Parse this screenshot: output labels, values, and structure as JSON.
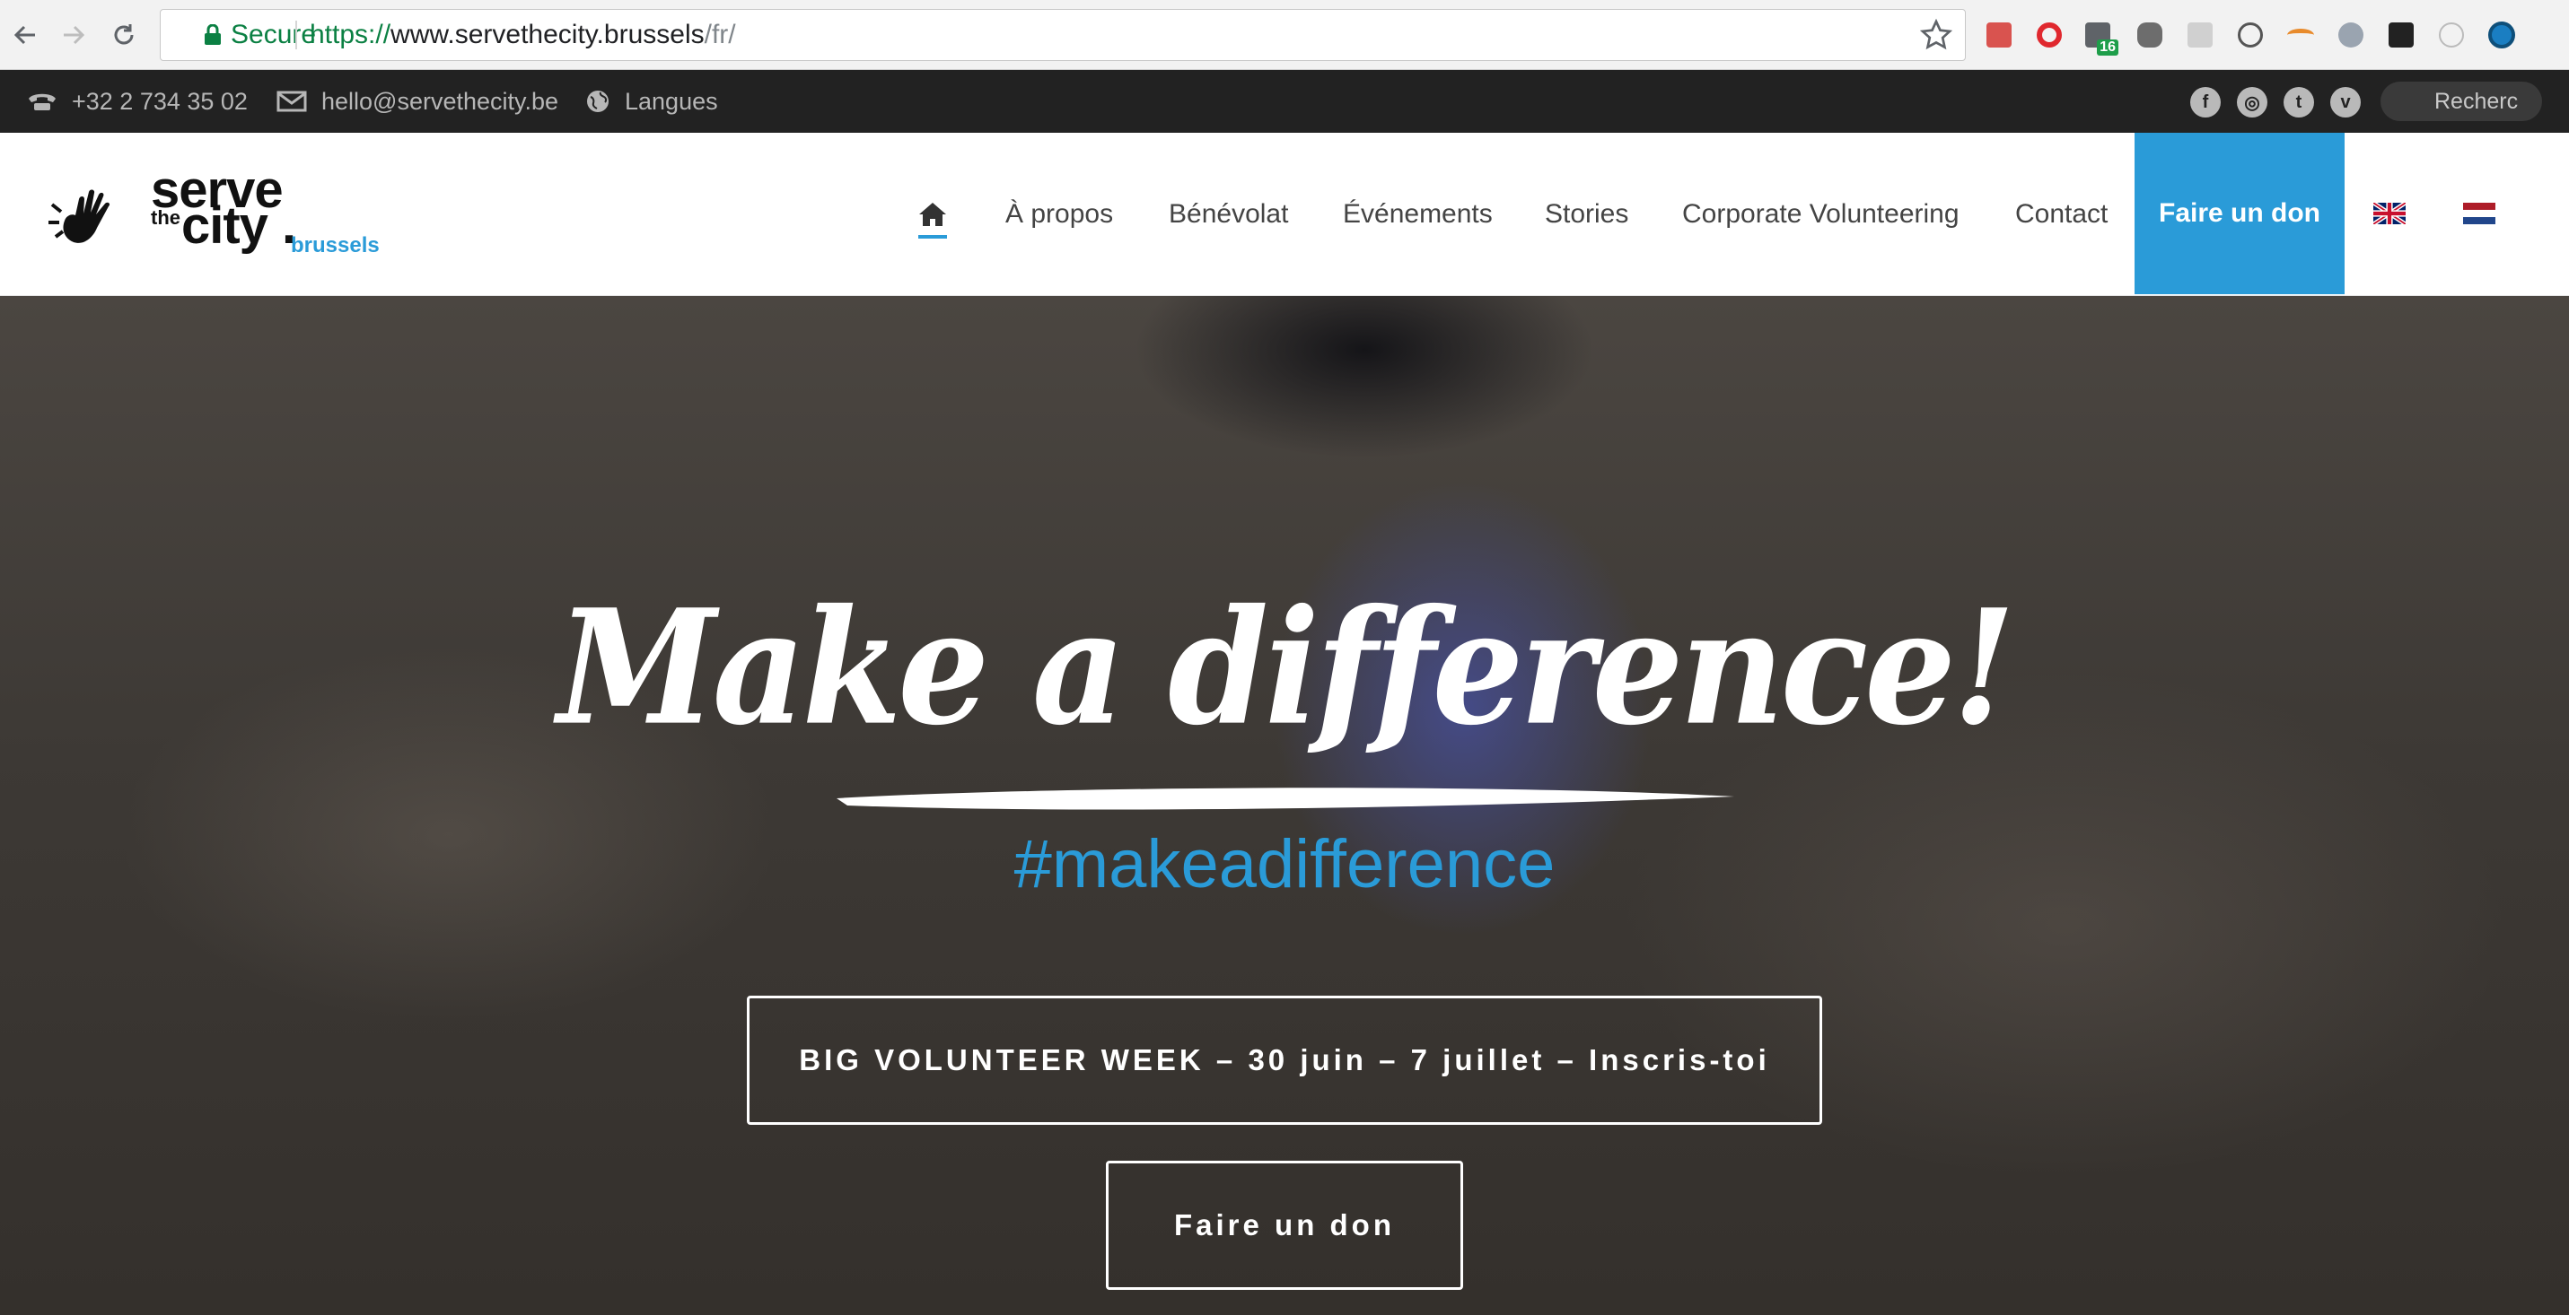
{
  "browser": {
    "secure_label": "Secure",
    "url_scheme": "https://",
    "url_host": "www.servethecity.brussels",
    "url_path": "/fr/",
    "extension_badge": "16"
  },
  "topbar": {
    "phone": "+32 2 734 35 02",
    "email": "hello@servethecity.be",
    "languages": "Langues",
    "social": [
      "f",
      "◎",
      "t",
      "v"
    ],
    "search_placeholder": "Recherc"
  },
  "logo": {
    "serve": "serve",
    "the": "the",
    "city": "city",
    "dot": ".",
    "brussels": "brussels"
  },
  "nav": {
    "items": [
      "À propos",
      "Bénévolat",
      "Événements",
      "Stories",
      "Corporate Volunteering",
      "Contact"
    ],
    "donate": "Faire un don"
  },
  "hero": {
    "title": "Make a difference!",
    "hashtag": "#makeadifference",
    "cta_primary": "BIG VOLUNTEER WEEK – 30 juin – 7 juillet – Inscris-toi",
    "cta_secondary": "Faire un don"
  },
  "colors": {
    "accent": "#2a9bd8",
    "topbar_bg": "#222222",
    "secure_green": "#0b8043"
  }
}
